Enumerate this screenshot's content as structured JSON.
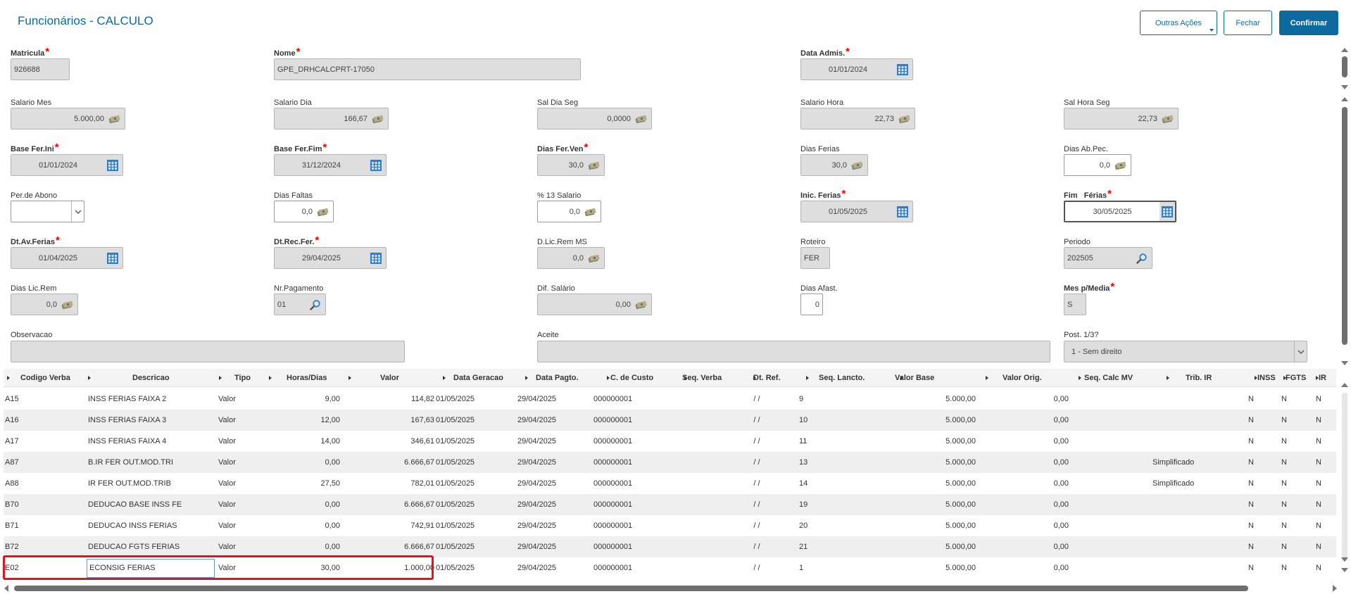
{
  "header": {
    "title": "Funcionários - CALCULO",
    "buttons": {
      "outras": "Outras Ações",
      "fechar": "Fechar",
      "confirmar": "Confirmar"
    }
  },
  "form": {
    "matricula": {
      "label": "Matricula",
      "value": "926688"
    },
    "nome": {
      "label": "Nome",
      "value": "GPE_DRHCALCPRT-17050"
    },
    "data_admis": {
      "label": "Data Admis.",
      "value": "01/01/2024"
    },
    "salario_mes": {
      "label": "Salario Mes",
      "value": "5.000,00"
    },
    "salario_dia": {
      "label": "Salario Dia",
      "value": "166,67"
    },
    "sal_dia_seg": {
      "label": "Sal Dia Seg",
      "value": "0,0000"
    },
    "salario_hora": {
      "label": "Salario Hora",
      "value": "22,73"
    },
    "sal_hora_seg": {
      "label": "Sal Hora Seg",
      "value": "22,73"
    },
    "base_fer_ini": {
      "label": "Base Fer.Ini",
      "value": "01/01/2024"
    },
    "base_fer_fim": {
      "label": "Base Fer.Fim",
      "value": "31/12/2024"
    },
    "dias_fer_ven": {
      "label": "Dias Fer.Ven",
      "value": "30,0"
    },
    "dias_ferias": {
      "label": "Dias Ferias",
      "value": "30,0"
    },
    "dias_ab_pec": {
      "label": "Dias Ab.Pec.",
      "value": "0,0"
    },
    "per_abono": {
      "label": "Per.de Abono",
      "value": ""
    },
    "dias_faltas": {
      "label": "Dias Faltas",
      "value": "0,0"
    },
    "pct_13": {
      "label": "% 13 Salario",
      "value": "0,0"
    },
    "inic_ferias": {
      "label": "Inic. Ferias",
      "value": "01/05/2025"
    },
    "fim_ferias": {
      "label": "Fim   Férias",
      "value": "30/05/2025"
    },
    "dt_av_ferias": {
      "label": "Dt.Av.Ferias",
      "value": "01/04/2025"
    },
    "dt_rec_fer": {
      "label": "Dt.Rec.Fer.",
      "value": "29/04/2025"
    },
    "d_lic_rem_ms": {
      "label": "D.Lic.Rem MS",
      "value": "0,0"
    },
    "roteiro": {
      "label": "Roteiro",
      "value": "FER"
    },
    "periodo": {
      "label": "Periodo",
      "value": "202505"
    },
    "dias_lic_rem": {
      "label": "Dias Lic.Rem",
      "value": "0,0"
    },
    "nr_pagamento": {
      "label": "Nr.Pagamento",
      "value": "01"
    },
    "dif_salario": {
      "label": "Dif. Salário",
      "value": "0,00"
    },
    "dias_afast": {
      "label": "Dias Afast.",
      "value": "0"
    },
    "mes_p_media": {
      "label": "Mes p/Media",
      "value": "S"
    },
    "observacao": {
      "label": "Observacao",
      "value": ""
    },
    "aceite": {
      "label": "Aceite",
      "value": ""
    },
    "post_13": {
      "label": "Post. 1/3?",
      "value": "1 - Sem direito"
    }
  },
  "grid": {
    "columns": [
      "Codigo Verba",
      "Descricao",
      "Tipo",
      "Horas/Dias",
      "Valor",
      "Data Geracao",
      "Data Pagto.",
      "C. de Custo",
      "Seq. Verba",
      "Dt. Ref.",
      "Seq. Lancto.",
      "Valor Base",
      "Valor Orig.",
      "Seq. Calc MV",
      "Trib. IR",
      "INSS",
      "FGTS",
      "IR"
    ],
    "rows": [
      [
        "A15",
        "INSS FERIAS FAIXA 2",
        "Valor",
        "9,00",
        "114,82",
        "01/05/2025",
        "29/04/2025",
        "000000001",
        "",
        "/ /",
        "9",
        "5.000,00",
        "0,00",
        "",
        "",
        "N",
        "N",
        "N"
      ],
      [
        "A16",
        "INSS FERIAS FAIXA 3",
        "Valor",
        "12,00",
        "167,63",
        "01/05/2025",
        "29/04/2025",
        "000000001",
        "",
        "/ /",
        "10",
        "5.000,00",
        "0,00",
        "",
        "",
        "N",
        "N",
        "N"
      ],
      [
        "A17",
        "INSS FERIAS FAIXA 4",
        "Valor",
        "14,00",
        "346,61",
        "01/05/2025",
        "29/04/2025",
        "000000001",
        "",
        "/ /",
        "11",
        "5.000,00",
        "0,00",
        "",
        "",
        "N",
        "N",
        "N"
      ],
      [
        "A87",
        "B.IR FER OUT.MOD.TRI",
        "Valor",
        "0,00",
        "6.666,67",
        "01/05/2025",
        "29/04/2025",
        "000000001",
        "",
        "/ /",
        "13",
        "5.000,00",
        "0,00",
        "",
        "Simplificado",
        "N",
        "N",
        "N"
      ],
      [
        "A88",
        "IR FER OUT.MOD.TRIB",
        "Valor",
        "27,50",
        "782,01",
        "01/05/2025",
        "29/04/2025",
        "000000001",
        "",
        "/ /",
        "14",
        "5.000,00",
        "0,00",
        "",
        "Simplificado",
        "N",
        "N",
        "N"
      ],
      [
        "B70",
        "DEDUCAO BASE INSS FE",
        "Valor",
        "0,00",
        "6.666,67",
        "01/05/2025",
        "29/04/2025",
        "000000001",
        "",
        "/ /",
        "19",
        "5.000,00",
        "0,00",
        "",
        "",
        "N",
        "N",
        "N"
      ],
      [
        "B71",
        "DEDUCAO INSS FERIAS",
        "Valor",
        "0,00",
        "742,91",
        "01/05/2025",
        "29/04/2025",
        "000000001",
        "",
        "/ /",
        "20",
        "5.000,00",
        "0,00",
        "",
        "",
        "N",
        "N",
        "N"
      ],
      [
        "B72",
        "DEDUCAO FGTS FERIAS",
        "Valor",
        "0,00",
        "6.666,67",
        "01/05/2025",
        "29/04/2025",
        "000000001",
        "",
        "/ /",
        "21",
        "5.000,00",
        "0,00",
        "",
        "",
        "N",
        "N",
        "N"
      ],
      [
        "E02",
        "ECONSIG FERIAS",
        "Valor",
        "30,00",
        "1.000,00",
        "01/05/2025",
        "29/04/2025",
        "000000001",
        "",
        "/ /",
        "1",
        "5.000,00",
        "0,00",
        "",
        "",
        "N",
        "N",
        "N"
      ]
    ]
  },
  "colors": {
    "accent": "#0c6a9e",
    "highlight": "#e8121c"
  }
}
